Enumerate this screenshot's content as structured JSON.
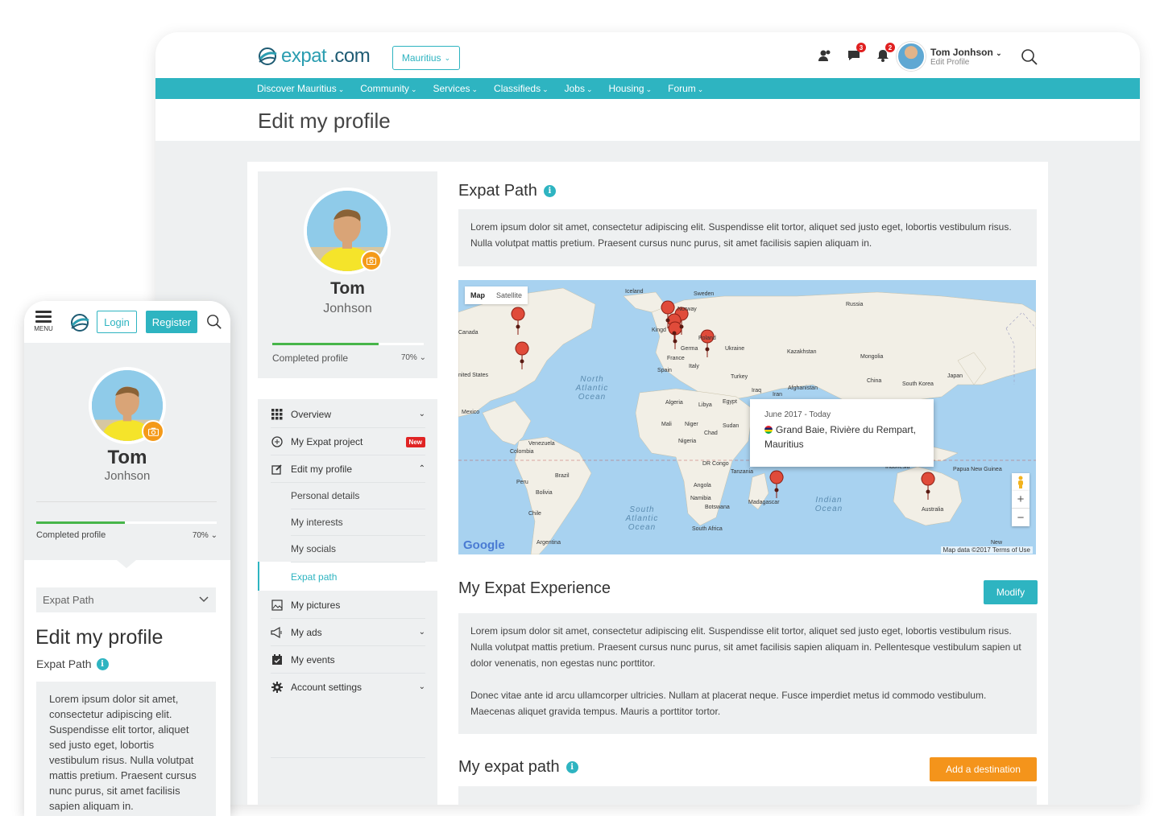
{
  "brand": {
    "name_light": "expat",
    "name_bold": ".com"
  },
  "header": {
    "country": "Mauritius",
    "badges": {
      "messages": "3",
      "notifications": "2"
    },
    "user_name": "Tom Jonhson",
    "user_sub": "Edit Profile"
  },
  "nav": [
    "Discover Mauritius",
    "Community",
    "Services",
    "Classifieds",
    "Jobs",
    "Housing",
    "Forum"
  ],
  "page_title": "Edit my profile",
  "profile": {
    "first": "Tom",
    "last": "Jonhson",
    "completed_label": "Completed profile",
    "completed_pct": "70%",
    "completed_value": 0.7
  },
  "menu": {
    "overview": "Overview",
    "expat_project": "My Expat project",
    "new_badge": "New",
    "edit_profile": "Edit my profile",
    "personal_details": "Personal details",
    "interests": "My interests",
    "socials": "My socials",
    "expat_path": "Expat path",
    "pictures": "My pictures",
    "ads": "My ads",
    "events": "My events",
    "account_settings": "Account settings"
  },
  "expat_path": {
    "title": "Expat Path",
    "text": "Lorem ipsum dolor sit amet, consectetur adipiscing elit. Suspendisse elit tortor, aliquet sed justo eget, lobortis vestibulum risus. Nulla volutpat mattis pretium. Praesent cursus nunc purus, sit amet facilisis sapien aliquam in."
  },
  "map": {
    "tab_map": "Map",
    "tab_satellite": "Satellite",
    "popup_date": "June 2017 - Today",
    "popup_place": "Grand Baie, Rivière du Rempart, Mauritius",
    "google": "Google",
    "attribution": "Map data ©2017  Terms of Use",
    "zoom_in": "+",
    "zoom_out": "−",
    "labels": {
      "iceland": "Iceland",
      "sweden": "Sweden",
      "norway": "Norway",
      "russia": "Russia",
      "canada": "Canada",
      "united_states": "nited States",
      "kingdom": "Kingd",
      "germany": "Germa",
      "poland": "Poland",
      "ukraine": "Ukraine",
      "france": "France",
      "spain": "Spain",
      "italy": "Italy",
      "kazakhstan": "Kazakhstan",
      "mongolia": "Mongolia",
      "turkey": "Turkey",
      "china": "China",
      "south_korea": "South Korea",
      "japan": "Japan",
      "iraq": "Iraq",
      "iran": "Iran",
      "afghanistan": "Afghanistan",
      "algeria": "Algeria",
      "libya": "Libya",
      "egypt": "Egypt",
      "mexico": "Mexico",
      "mali": "Mali",
      "niger": "Niger",
      "chad": "Chad",
      "sudan": "Sudan",
      "nigeria": "Nigeria",
      "venezuela": "Venezuela",
      "colombia": "Colombia",
      "brazil": "Brazil",
      "peru": "Peru",
      "bolivia": "Bolivia",
      "chile": "Chile",
      "argentina": "Argentina",
      "dr_congo": "DR Congo",
      "tanzania": "Tanzania",
      "angola": "Angola",
      "namibia": "Namibia",
      "botswana": "Botswana",
      "madagascar": "Madagascar",
      "south_africa": "South Africa",
      "indonesia": "Indonesia",
      "papua": "Papua New Guinea",
      "australia": "Australia",
      "new": "New"
    },
    "oceans": {
      "north_atlantic": "North Atlantic Ocean",
      "south_atlantic": "South Atlantic Ocean",
      "indian": "Indian Ocean"
    }
  },
  "experience": {
    "title": "My Expat Experience",
    "modify": "Modify",
    "p1": "Lorem ipsum dolor sit amet, consectetur adipiscing elit. Suspendisse elit tortor, aliquet sed justo eget, lobortis vestibulum risus. Nulla volutpat mattis pretium. Praesent cursus nunc purus, sit amet facilisis sapien aliquam in. Pellentesque vestibulum sapien ut dolor venenatis, non egestas nunc porttitor.",
    "p2": "Donec vitae ante id arcu ullamcorper ultricies. Nullam at placerat neque. Fusce imperdiet metus id commodo vestibulum. Maecenas aliquet gravida tempus. Mauris a porttitor tortor."
  },
  "my_path": {
    "title": "My expat path",
    "add": "Add a destination"
  },
  "mobile": {
    "menu_label": "MENU",
    "login": "Login",
    "register": "Register",
    "first": "Tom",
    "last": "Jonhson",
    "completed_label": "Completed profile",
    "completed_pct": "70%",
    "completed_value": 0.49,
    "select_value": "Expat Path",
    "title": "Edit my profile",
    "subtitle": "Expat Path",
    "lorem": "Lorem ipsum dolor sit amet, consectetur adipiscing elit. Suspendisse elit tortor, aliquet sed justo eget, lobortis vestibulum risus. Nulla volutpat mattis pretium. Praesent cursus nunc purus, sit amet facilisis sapien aliquam in."
  },
  "colors": {
    "accent": "#2eb4c1",
    "orange": "#f4941b",
    "progress": "#47b54a",
    "badge_red": "#e02020"
  }
}
